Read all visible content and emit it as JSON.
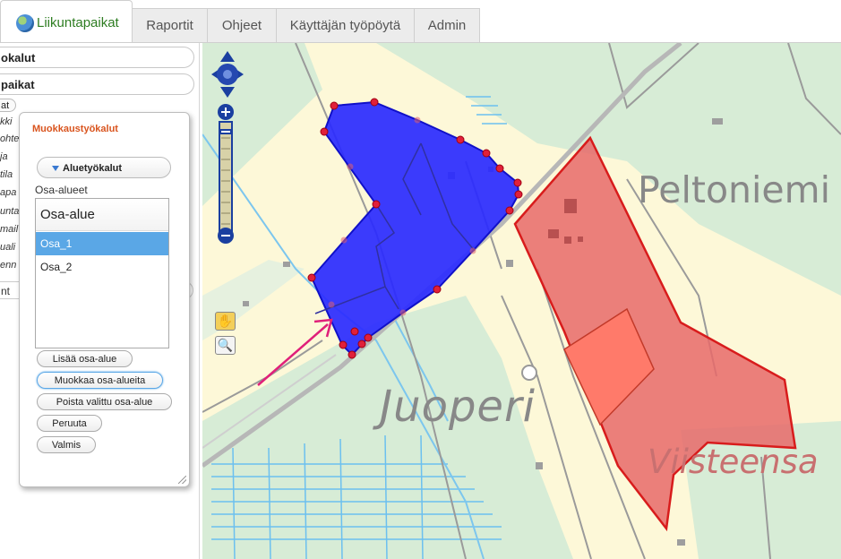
{
  "tabs": [
    {
      "label": "Liikuntapaikat",
      "active": true
    },
    {
      "label": "Raportit"
    },
    {
      "label": "Ohjeet"
    },
    {
      "label": "Käyttäjän työpöytä"
    },
    {
      "label": "Admin"
    }
  ],
  "sidebar": {
    "bar1": "okalut",
    "bar2": "paikat",
    "small_pill": "at",
    "items": [
      "kki",
      "ohte",
      "ja",
      "tila",
      "apa",
      "unta",
      "mail",
      "uali",
      "enn"
    ],
    "bottom_pill": "nt"
  },
  "dialog": {
    "title": "Muokkaustyökalut",
    "section": "Aluetyökalut",
    "field_label": "Osa-alueet",
    "list_header": "Osa-alue",
    "rows": [
      "Osa_1",
      "Osa_2"
    ],
    "selected_row": "Osa_1",
    "buttons": {
      "add": "Lisää osa-alue",
      "edit": "Muokkaa osa-alueita",
      "delete": "Poista valittu osa-alue",
      "cancel": "Peruuta",
      "done": "Valmis"
    }
  },
  "map": {
    "place_names": [
      "Peltoniemi",
      "Juoperi",
      "Viisteensa"
    ],
    "colors": {
      "selected_area": "#2a2aff",
      "other_area": "#e86a6a",
      "vertex": "#e0203a",
      "arrow": "#e0207a",
      "nav_blue": "#1a3fa0"
    },
    "icons": [
      "pan-hand-icon",
      "zoom-box-icon",
      "pan-arrows-icon",
      "zoom-in-icon",
      "zoom-out-icon"
    ]
  }
}
